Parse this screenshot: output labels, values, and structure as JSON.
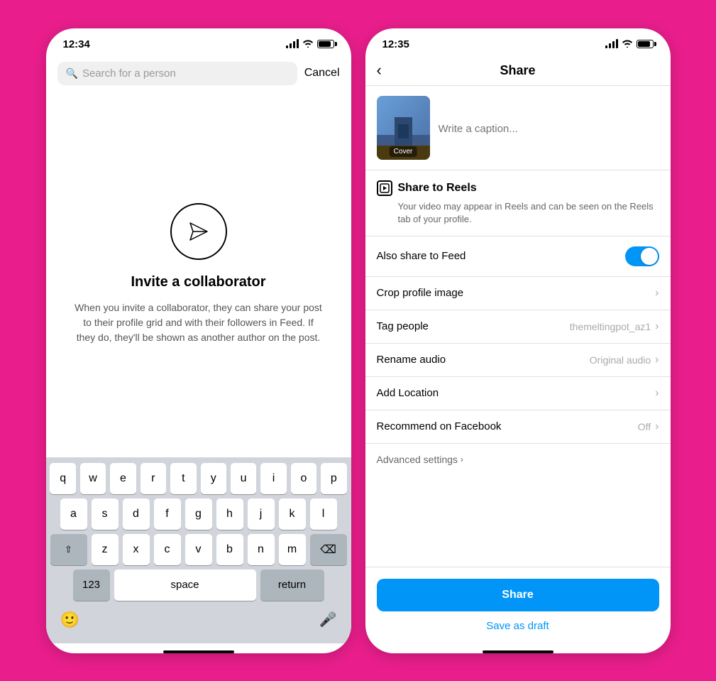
{
  "background_color": "#E91E8C",
  "screen1": {
    "status_time": "12:34",
    "search_placeholder": "Search for a person",
    "cancel_label": "Cancel",
    "invite_title": "Invite a collaborator",
    "invite_desc": "When you invite a collaborator, they can share your post to their profile grid and with their followers in Feed. If they do, they'll be shown as another author on the post.",
    "keyboard_rows": [
      [
        "q",
        "w",
        "e",
        "r",
        "t",
        "y",
        "u",
        "i",
        "o",
        "p"
      ],
      [
        "a",
        "s",
        "d",
        "f",
        "g",
        "h",
        "j",
        "k",
        "l"
      ],
      [
        "z",
        "x",
        "c",
        "v",
        "b",
        "n",
        "m"
      ]
    ],
    "key_123": "123",
    "key_space": "space",
    "key_return": "return"
  },
  "screen2": {
    "status_time": "12:35",
    "title": "Share",
    "caption_placeholder": "Write a caption...",
    "cover_label": "Cover",
    "reels_title": "Share to Reels",
    "reels_desc": "Your video may appear in Reels and can be seen on the Reels tab of your profile.",
    "options": [
      {
        "label": "Also share to Feed",
        "type": "toggle",
        "value": true
      },
      {
        "label": "Crop profile image",
        "type": "chevron",
        "value": ""
      },
      {
        "label": "Tag people",
        "type": "chevron",
        "value": "themeltingpot_az1"
      },
      {
        "label": "Rename audio",
        "type": "chevron",
        "value": "Original audio"
      },
      {
        "label": "Add Location",
        "type": "chevron",
        "value": ""
      },
      {
        "label": "Recommend on Facebook",
        "type": "chevron",
        "value": "Off"
      }
    ],
    "advanced_settings": "Advanced settings",
    "share_button": "Share",
    "save_draft": "Save as draft"
  }
}
